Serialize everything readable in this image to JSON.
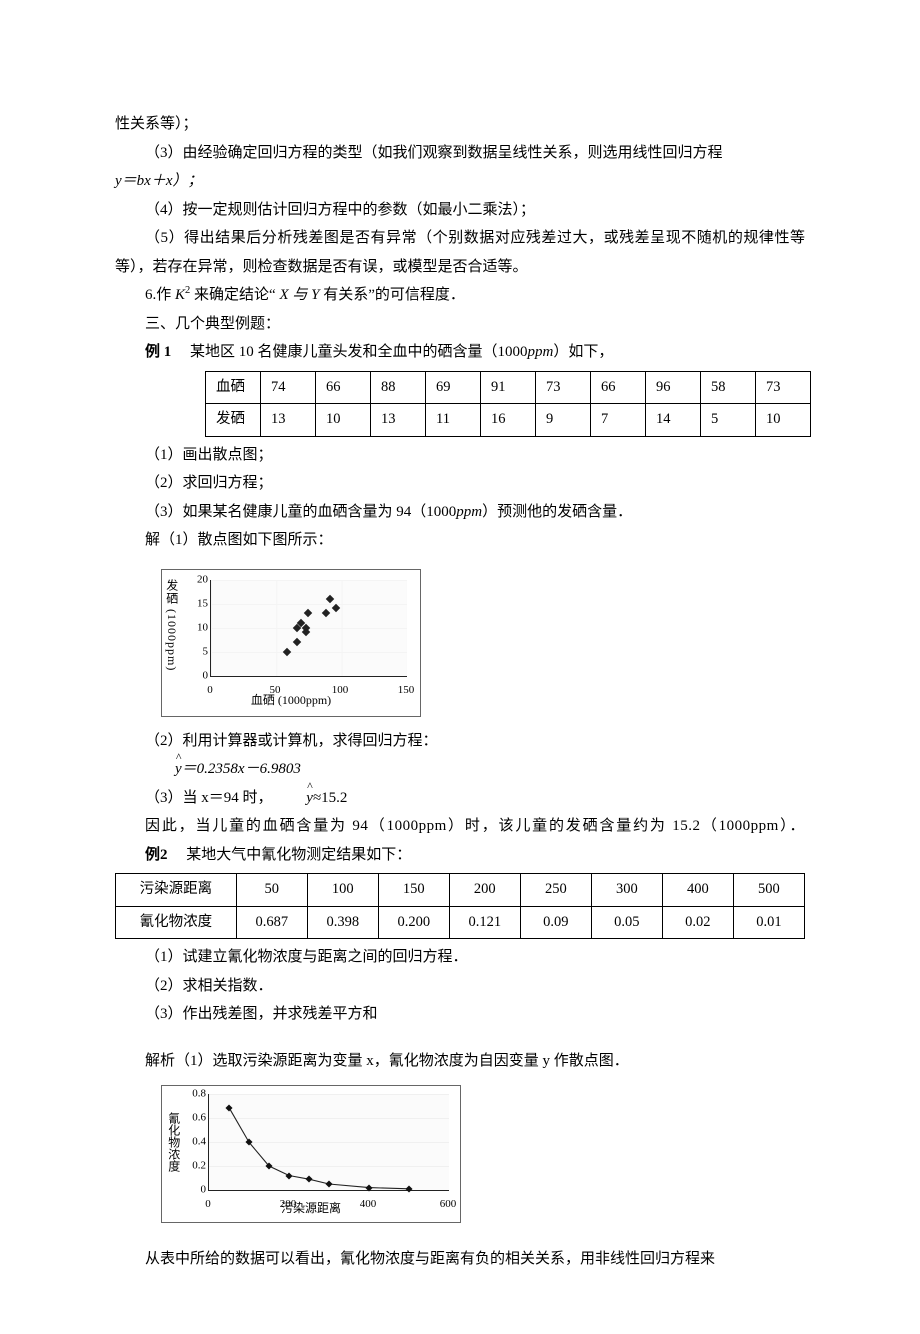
{
  "intro": {
    "line0": "性关系等）；",
    "line3": "（3）由经验确定回归方程的类型（如我们观察到数据呈线性关系，则选用线性回归方程",
    "line3b": "y＝bx＋x）；",
    "line4": "（4）按一定规则估计回归方程中的参数（如最小二乘法）；",
    "line5": "（5）得出结果后分析残差图是否有异常（个别数据对应残差过大，或残差呈现不随机的规律性等等），若存在异常，则检查数据是否有误，或模型是否合适等。",
    "line6a": "6.作 ",
    "line6b": " 来确定结论“",
    "line6c": " 有关系”的可信程度．",
    "k2": "K",
    "xy": "X 与 Y",
    "section": "三、几个典型例题：",
    "ex1label": "例 1",
    "ex1text": "　某地区 10 名健康儿童头发和全血中的硒含量（1000",
    "ex1unit": "ppm",
    "ex1tail": "）如下，"
  },
  "table1": {
    "r1": [
      "血硒",
      "74",
      "66",
      "88",
      "69",
      "91",
      "73",
      "66",
      "96",
      "58",
      "73"
    ],
    "r2": [
      "发硒",
      "13",
      "10",
      "13",
      "11",
      "16",
      "9",
      "7",
      "14",
      "5",
      "10"
    ]
  },
  "q1": {
    "a": "（1）画出散点图；",
    "b": "（2）求回归方程；",
    "c1": "（3）如果某名健康儿童的血硒含量为 94（1000",
    "c2": "）预测他的发硒含量．",
    "sol": "解（1）散点图如下图所示："
  },
  "chart_data": [
    {
      "type": "scatter",
      "title": "",
      "xlabel": "血硒 (1000ppm)",
      "ylabel": "发硒 (1000ppm)",
      "xlim": [
        0,
        150
      ],
      "ylim": [
        0,
        20
      ],
      "xticks": [
        0,
        50,
        100,
        150
      ],
      "yticks": [
        0,
        5,
        10,
        15,
        20
      ],
      "x": [
        74,
        66,
        88,
        69,
        91,
        73,
        66,
        96,
        58,
        73
      ],
      "y": [
        13,
        10,
        13,
        11,
        16,
        9,
        7,
        14,
        5,
        10
      ]
    },
    {
      "type": "scatter-line",
      "title": "",
      "xlabel": "污染源距离",
      "ylabel": "氰化物浓度",
      "xlim": [
        0,
        600
      ],
      "ylim": [
        0,
        0.8
      ],
      "xticks": [
        0,
        200,
        400,
        600
      ],
      "yticks": [
        0,
        0.2,
        0.4,
        0.6,
        0.8
      ],
      "x": [
        50,
        100,
        150,
        200,
        250,
        300,
        400,
        500
      ],
      "y": [
        0.687,
        0.398,
        0.2,
        0.121,
        0.09,
        0.05,
        0.02,
        0.01
      ]
    }
  ],
  "mid": {
    "m2": "（2）利用计算器或计算机，求得回归方程：",
    "eq": "＝0.2358x－6.9803",
    "m3a": "（3）当 x＝94 时，",
    "m3b": "≈15.2",
    "concl": "因此，当儿童的血硒含量为 94（1000ppm）时，该儿童的发硒含量约为 15.2（1000ppm）．"
  },
  "ex2": {
    "label": "例2",
    "text": "　某地大气中氰化物测定结果如下："
  },
  "table2": {
    "r1": [
      "污染源距离",
      "50",
      "100",
      "150",
      "200",
      "250",
      "300",
      "400",
      "500"
    ],
    "r2": [
      "氰化物浓度",
      "0.687",
      "0.398",
      "0.200",
      "0.121",
      "0.09",
      "0.05",
      "0.02",
      "0.01"
    ]
  },
  "q2": {
    "a": "（1）试建立氰化物浓度与距离之间的回归方程．",
    "b": "（2）求相关指数．",
    "c": "（3）作出残差图，并求残差平方和",
    "sol": "解析（1）选取污染源距离为变量 x，氰化物浓度为自因变量 y 作散点图．",
    "tail": "从表中所给的数据可以看出，氰化物浓度与距离有负的相关关系，用非线性回归方程来"
  }
}
